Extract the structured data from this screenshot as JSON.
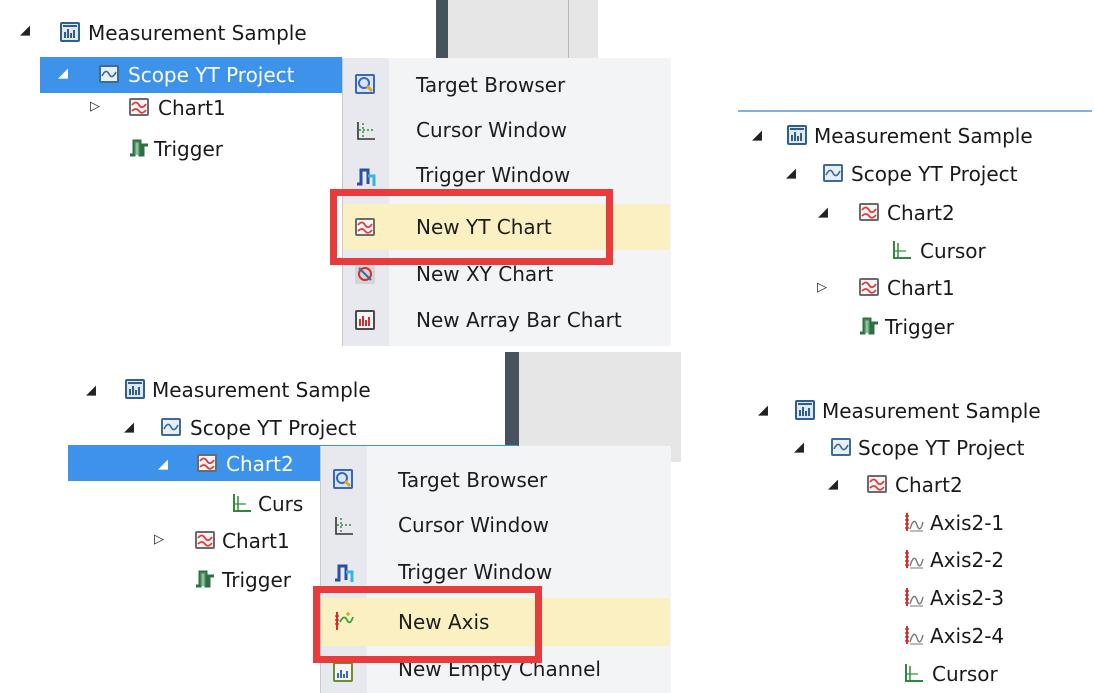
{
  "panel_top_left": {
    "tree": {
      "root": "Measurement Sample",
      "project": "Scope YT Project",
      "chart": "Chart1",
      "trigger": "Trigger"
    },
    "menu": {
      "items": [
        "Target Browser",
        "Cursor Window",
        "Trigger Window",
        "New YT Chart",
        "New XY Chart",
        "New Array Bar Chart"
      ],
      "highlighted": "New YT Chart"
    }
  },
  "panel_top_right": {
    "tree": {
      "root": "Measurement Sample",
      "project": "Scope YT Project",
      "chart_new": "Chart2",
      "cursor": "Cursor",
      "chart_old": "Chart1",
      "trigger": "Trigger"
    }
  },
  "panel_bottom_left": {
    "tree": {
      "root": "Measurement Sample",
      "project": "Scope YT Project",
      "chart_selected": "Chart2",
      "cursor_partial": "Curs",
      "chart_old": "Chart1",
      "trigger_partial": "Trigger"
    },
    "menu": {
      "items": [
        "Target Browser",
        "Cursor Window",
        "Trigger Window",
        "New Axis",
        "New Empty Channel"
      ],
      "highlighted": "New Axis"
    }
  },
  "panel_bottom_right": {
    "tree": {
      "root": "Measurement Sample",
      "project": "Scope YT Project",
      "chart": "Chart2",
      "axes": [
        "Axis2-1",
        "Axis2-2",
        "Axis2-3",
        "Axis2-4"
      ],
      "cursor": "Cursor"
    }
  },
  "colors": {
    "selection": "#3d93ea",
    "menu_bg": "#f3f4f6",
    "highlight": "#fbf0c2",
    "red_box": "#e83b3b"
  }
}
